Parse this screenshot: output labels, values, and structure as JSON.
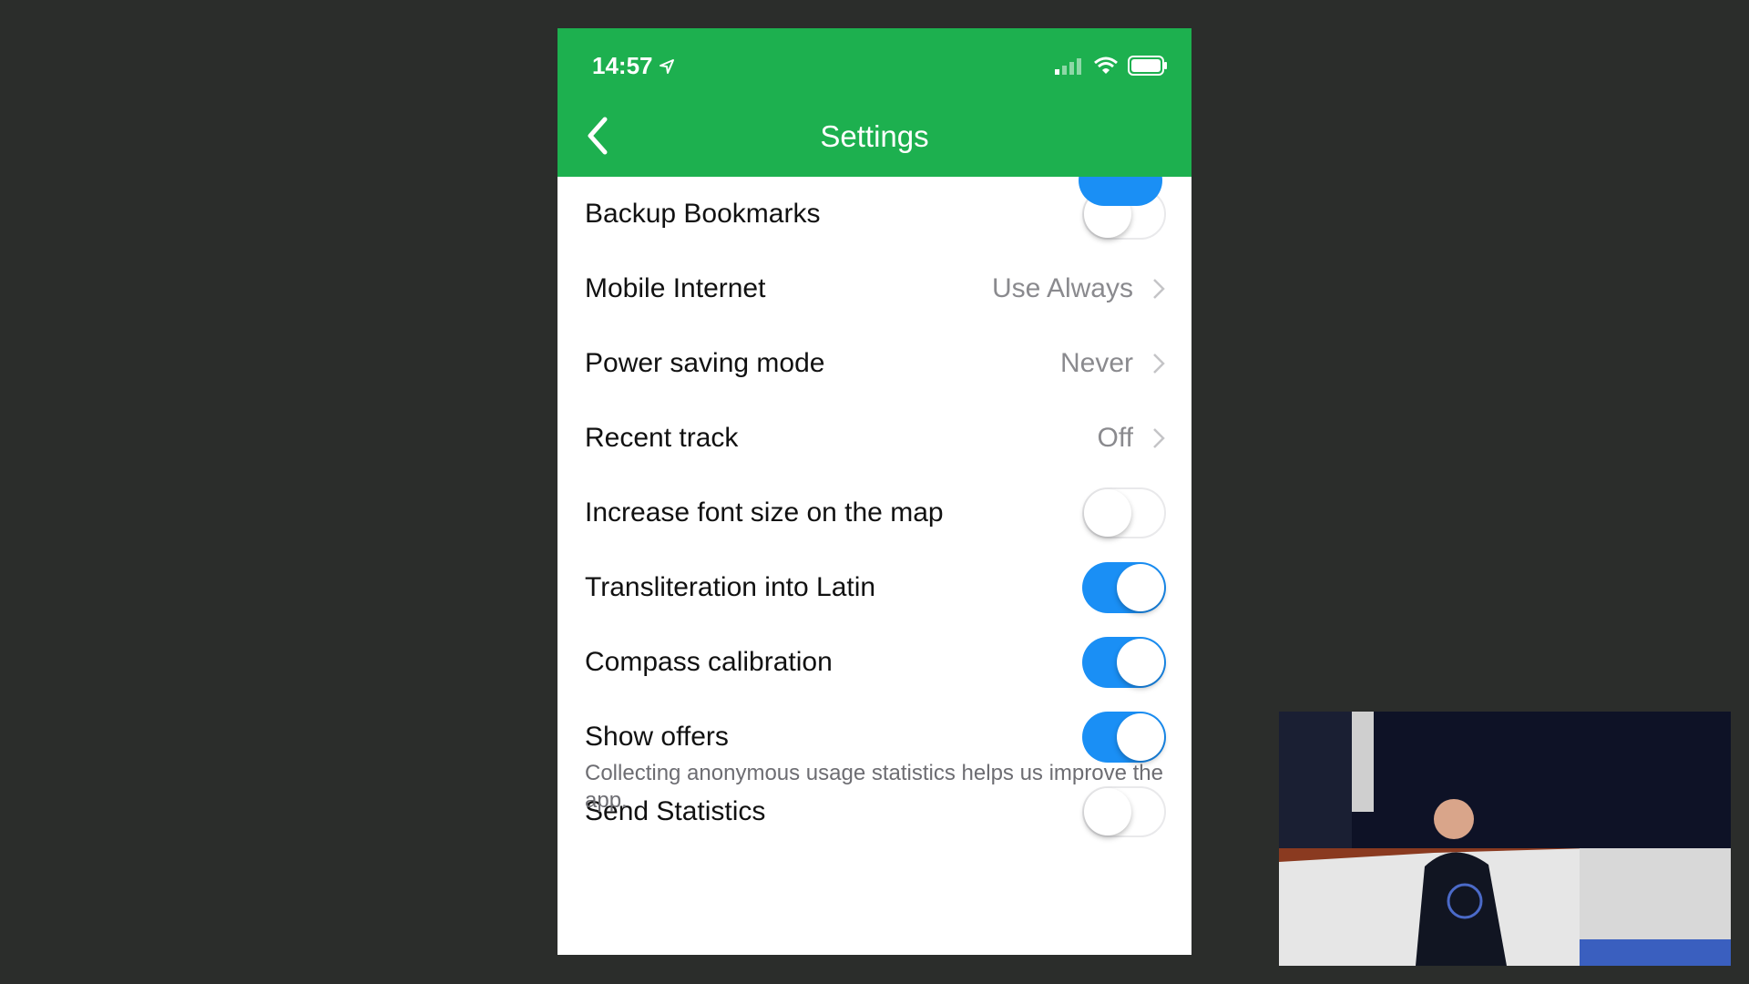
{
  "status_bar": {
    "time": "14:57"
  },
  "nav": {
    "title": "Settings"
  },
  "rows": [
    {
      "label": "Backup Bookmarks",
      "type": "toggle",
      "on": false
    },
    {
      "label": "Mobile Internet",
      "type": "value",
      "value": "Use Always"
    },
    {
      "label": "Power saving mode",
      "type": "value",
      "value": "Never"
    },
    {
      "label": "Recent track",
      "type": "value",
      "value": "Off"
    },
    {
      "label": "Increase font size on the map",
      "type": "toggle",
      "on": false
    },
    {
      "label": "Transliteration into Latin",
      "type": "toggle",
      "on": true
    },
    {
      "label": "Compass calibration",
      "type": "toggle",
      "on": true
    },
    {
      "label": "Show offers",
      "type": "toggle",
      "on": true
    },
    {
      "label": "Send Statistics",
      "type": "toggle",
      "on": false
    }
  ],
  "footnote": "Collecting anonymous usage statistics helps us improve the app.",
  "colors": {
    "header": "#1db04f",
    "toggle_on": "#1a8ff5",
    "background": "#2b2d2b"
  },
  "icons": [
    "location-arrow-icon",
    "cellular-signal-icon",
    "wifi-icon",
    "battery-icon",
    "back-chevron-icon",
    "chevron-right-icon"
  ]
}
